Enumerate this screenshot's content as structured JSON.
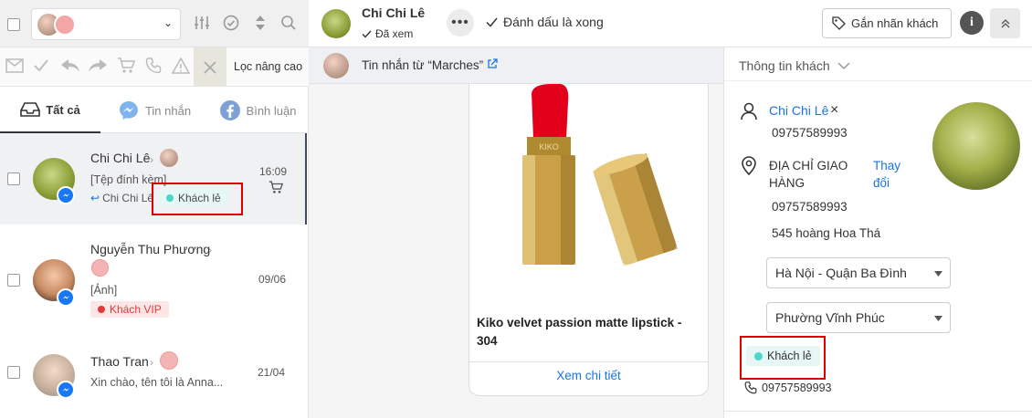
{
  "colors": {
    "accent": "#1a73e8",
    "cyan": "#4cd5c9",
    "vip": "#e53935",
    "highlight": "#e00000"
  },
  "left": {
    "toolbar": {
      "advanced_filter": "Lọc nâng cao"
    },
    "tabs": [
      {
        "label": "Tất cả",
        "icon": "inbox-icon"
      },
      {
        "label": "Tin nhắn",
        "icon": "messenger-icon"
      },
      {
        "label": "Bình luận",
        "icon": "facebook-icon"
      }
    ],
    "conversations": [
      {
        "name": "Chi Chi Lê",
        "preview": "[Tệp đính kèm]",
        "reply_from": "Chi Chi Lê",
        "tag": "Khách lẻ",
        "time": "16:09"
      },
      {
        "name": "Nguyễn Thu Phương",
        "preview": "[Ảnh]",
        "tag": "Khách VIP",
        "time": "09/06"
      },
      {
        "name": "Thao Tran",
        "preview": "Xin chào, tên tôi là Anna...",
        "time": "21/04"
      }
    ]
  },
  "mid": {
    "name": "Chi Chi Lê",
    "status": "Đã xem",
    "mark_done": "Đánh dấu là xong",
    "message_from": "Tin nhắn từ  “Marches”",
    "product_title": "Kiko velvet passion matte lipstick - 304",
    "product_brand": "KIKO",
    "view_detail": "Xem chi tiết",
    "tag_button": "Gắn nhãn khách"
  },
  "right": {
    "section_title": "Thông tin khách",
    "customer_name": "Chi Chi Lê",
    "phone": "09757589993",
    "address_label": "ĐỊA CHỈ GIAO HÀNG",
    "change_link": "Thay đổi",
    "address_phone": "09757589993",
    "street": "545 hoàng Hoa Thá",
    "district": "Hà Nội - Quận Ba Đình",
    "ward": "Phường Vĩnh Phúc",
    "tag": "Khách lẻ",
    "contact_phone": "09757589993"
  }
}
